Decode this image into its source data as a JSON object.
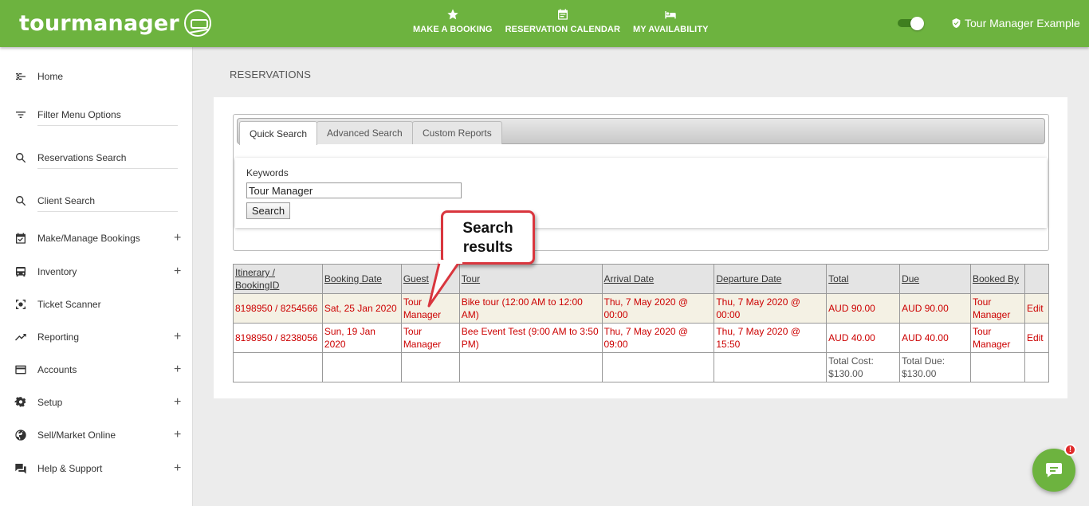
{
  "header": {
    "logo_text": "tourmanager",
    "nav": [
      {
        "label": "MAKE A BOOKING",
        "icon": "star-icon"
      },
      {
        "label": "RESERVATION CALENDAR",
        "icon": "calendar-icon"
      },
      {
        "label": "MY AVAILABILITY",
        "icon": "bed-icon"
      }
    ],
    "user_name": "Tour Manager Example",
    "accent_color": "#6db33f"
  },
  "sidebar": {
    "items": [
      {
        "label": "Home",
        "icon": "back-arrow-icon"
      },
      {
        "label": "Filter Menu Options",
        "icon": "filter-icon"
      },
      {
        "label": "Reservations Search",
        "icon": "search-icon"
      },
      {
        "label": "Client Search",
        "icon": "search-icon"
      },
      {
        "label": "Make/Manage Bookings",
        "icon": "calendar-check-icon",
        "expand": "+"
      },
      {
        "label": "Inventory",
        "icon": "bus-icon",
        "expand": "+"
      },
      {
        "label": "Ticket Scanner",
        "icon": "scanner-icon"
      },
      {
        "label": "Reporting",
        "icon": "trending-icon",
        "expand": "+"
      },
      {
        "label": "Accounts",
        "icon": "card-icon",
        "expand": "+"
      },
      {
        "label": "Setup",
        "icon": "gear-icon",
        "expand": "+"
      },
      {
        "label": "Sell/Market Online",
        "icon": "globe-icon",
        "expand": "+"
      },
      {
        "label": "Help & Support",
        "icon": "chat-icon",
        "expand": "+"
      }
    ]
  },
  "main": {
    "page_title": "RESERVATIONS",
    "tabs": [
      {
        "label": "Quick Search",
        "active": true
      },
      {
        "label": "Advanced Search",
        "active": false
      },
      {
        "label": "Custom Reports",
        "active": false
      }
    ],
    "search": {
      "keywords_label": "Keywords",
      "keywords_value": "Tour Manager",
      "button_label": "Search"
    },
    "table": {
      "headers": [
        "Itinerary / BookingID",
        "Booking Date",
        "Guest",
        "Tour",
        "Arrival Date",
        "Departure Date",
        "Total",
        "Due",
        "Booked By",
        ""
      ],
      "rows": [
        {
          "itinerary": "8198950 / 8254566",
          "booking_date": "Sat, 25 Jan 2020",
          "guest": "Tour Manager",
          "tour": "Bike tour (12:00 AM to 12:00 AM)",
          "arrival": "Thu, 7 May 2020 @ 00:00",
          "departure": "Thu, 7 May 2020 @ 00:00",
          "total": "AUD 90.00",
          "due": "AUD 90.00",
          "booked_by": "Tour Manager",
          "action": "Edit"
        },
        {
          "itinerary": "8198950 / 8238056",
          "booking_date": "Sun, 19 Jan 2020",
          "guest": "Tour Manager",
          "tour": "Bee Event Test (9:00 AM to 3:50 PM)",
          "arrival": "Thu, 7 May 2020 @ 09:00",
          "departure": "Thu, 7 May 2020 @ 15:50",
          "total": "AUD 40.00",
          "due": "AUD 40.00",
          "booked_by": "Tour Manager",
          "action": "Edit"
        }
      ],
      "totals": {
        "total_cost": "Total Cost: $130.00",
        "total_due": "Total Due: $130.00"
      }
    },
    "callout": "Search results"
  },
  "chat": {
    "badge": "!"
  }
}
